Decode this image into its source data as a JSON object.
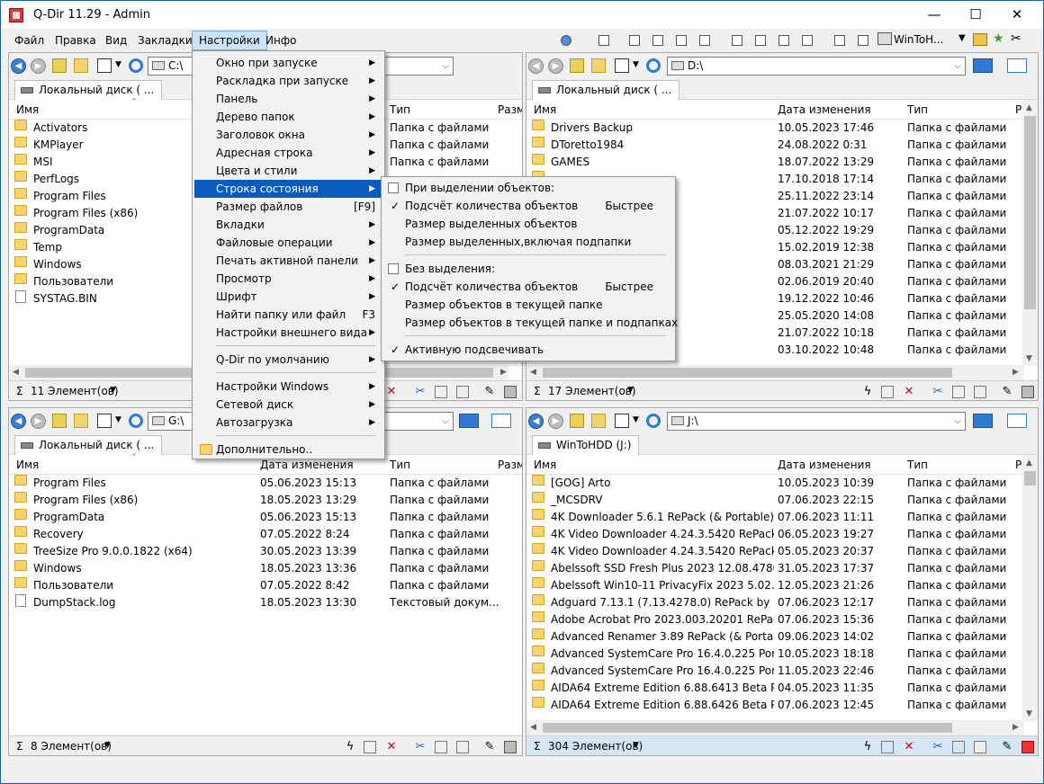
{
  "window": {
    "title": "Q-Dir 11.29 - Admin",
    "minimize": "—",
    "maximize": "☐",
    "close": "✕"
  },
  "menubar": [
    {
      "label": "Файл"
    },
    {
      "label": "Правка"
    },
    {
      "label": "Вид"
    },
    {
      "label": "Закладки"
    },
    {
      "label": "Настройки"
    },
    {
      "label": "Инфо"
    }
  ],
  "toolbar_right": {
    "drive_label": "WinToH..."
  },
  "panes": [
    {
      "address": "C:\\",
      "tab": "Локальный диск ( ...",
      "headers": [
        "Имя",
        "Дата изменения",
        "Тип",
        "Разм"
      ],
      "rows": [
        {
          "name": "Activators",
          "date": "",
          "type": "Папка с файлами",
          "icon": "folder"
        },
        {
          "name": "KMPlayer",
          "date": "",
          "type": "Папка с файлами",
          "icon": "folder"
        },
        {
          "name": "MSI",
          "date": "",
          "type": "Папка с файлами",
          "icon": "folder"
        },
        {
          "name": "PerfLogs",
          "date": "",
          "type": "",
          "icon": "folder"
        },
        {
          "name": "Program Files",
          "date": "",
          "type": "",
          "icon": "folder"
        },
        {
          "name": "Program Files (x86)",
          "date": "",
          "type": "",
          "icon": "folder"
        },
        {
          "name": "ProgramData",
          "date": "",
          "type": "",
          "icon": "folder"
        },
        {
          "name": "Temp",
          "date": "",
          "type": "",
          "icon": "folder"
        },
        {
          "name": "Windows",
          "date": "",
          "type": "",
          "icon": "folder"
        },
        {
          "name": "Пользователи",
          "date": "",
          "type": "",
          "icon": "folder"
        },
        {
          "name": "SYSTAG.BIN",
          "date": "",
          "type": "",
          "icon": "file"
        }
      ],
      "status": "11 Элемент(ов)"
    },
    {
      "address": "D:\\",
      "tab": "Локальный диск ( ...",
      "headers": [
        "Имя",
        "Дата изменения",
        "Тип",
        "Р"
      ],
      "rows": [
        {
          "name": "Drivers Backup",
          "date": "10.05.2023 17:46",
          "type": "Папка с файлами",
          "icon": "folder"
        },
        {
          "name": "DToretto1984",
          "date": "24.08.2022 0:31",
          "type": "Папка с файлами",
          "icon": "folder"
        },
        {
          "name": "GAMES",
          "date": "18.07.2022 13:29",
          "type": "Папка с файлами",
          "icon": "folder"
        },
        {
          "name": "",
          "date": "17.10.2018 17:14",
          "type": "Папка с файлами",
          "icon": "folder"
        },
        {
          "name": "",
          "date": "25.11.2022 23:14",
          "type": "Папка с файлами",
          "icon": "folder"
        },
        {
          "name": "",
          "date": "21.07.2022 10:17",
          "type": "Папка с файлами",
          "icon": "folder"
        },
        {
          "name": "",
          "date": "05.12.2022 19:29",
          "type": "Папка с файлами",
          "icon": "folder"
        },
        {
          "name": "",
          "date": "15.02.2019 12:38",
          "type": "Папка с файлами",
          "icon": "folder"
        },
        {
          "name": "",
          "date": "08.03.2021 21:29",
          "type": "Папка с файлами",
          "icon": "folder"
        },
        {
          "name": "",
          "date": "02.06.2019 20:40",
          "type": "Папка с файлами",
          "icon": "folder"
        },
        {
          "name": "",
          "date": "19.12.2022 10:46",
          "type": "Папка с файлами",
          "icon": "folder"
        },
        {
          "name": "",
          "date": "25.05.2020 14:08",
          "type": "Папка с файлами",
          "icon": "folder"
        },
        {
          "name": "",
          "date": "21.07.2022 10:18",
          "type": "Папка с файлами",
          "icon": "folder"
        },
        {
          "name": "",
          "date": "03.10.2022 10:48",
          "type": "Папка с файлами",
          "icon": "folder"
        }
      ],
      "status": "17 Элемент(ов)"
    },
    {
      "address": "G:\\",
      "tab": "Локальный диск ( ...",
      "headers": [
        "Имя",
        "Дата изменения",
        "Тип",
        "Разм"
      ],
      "rows": [
        {
          "name": "Program Files",
          "date": "05.06.2023 15:13",
          "type": "Папка с файлами",
          "icon": "folder"
        },
        {
          "name": "Program Files (x86)",
          "date": "18.05.2023 13:29",
          "type": "Папка с файлами",
          "icon": "folder"
        },
        {
          "name": "ProgramData",
          "date": "05.06.2023 15:13",
          "type": "Папка с файлами",
          "icon": "folder"
        },
        {
          "name": "Recovery",
          "date": "07.05.2022 8:24",
          "type": "Папка с файлами",
          "icon": "folder"
        },
        {
          "name": "TreeSize Pro 9.0.0.1822 (x64)",
          "date": "30.05.2023 13:39",
          "type": "Папка с файлами",
          "icon": "folder"
        },
        {
          "name": "Windows",
          "date": "18.05.2023 13:36",
          "type": "Папка с файлами",
          "icon": "folder"
        },
        {
          "name": "Пользователи",
          "date": "07.05.2022 8:42",
          "type": "Папка с файлами",
          "icon": "folder"
        },
        {
          "name": "DumpStack.log",
          "date": "18.05.2023 13:30",
          "type": "Текстовый докум...",
          "icon": "file"
        }
      ],
      "status": "8 Элемент(ов)"
    },
    {
      "address": "J:\\",
      "tab": "WinToHDD (J:)",
      "headers": [
        "Имя",
        "Дата изменения",
        "Тип",
        "Р"
      ],
      "rows": [
        {
          "name": "[GOG] Arto",
          "date": "10.05.2023 10:39",
          "type": "Папка с файлами",
          "icon": "folder"
        },
        {
          "name": "_MCSDRV",
          "date": "07.06.2023 22:15",
          "type": "Папка с файлами",
          "icon": "folder"
        },
        {
          "name": "4K Downloader 5.6.1 RePack (& Portable) by...",
          "date": "07.06.2023 11:11",
          "type": "Папка с файлами",
          "icon": "folder"
        },
        {
          "name": "4K Video Downloader 4.24.3.5420 RePack (&...",
          "date": "06.05.2023 19:27",
          "type": "Папка с файлами",
          "icon": "folder"
        },
        {
          "name": "4K Video Downloader 4.24.3.5420 RePack (&...",
          "date": "05.05.2023 20:37",
          "type": "Папка с файлами",
          "icon": "folder"
        },
        {
          "name": "Abelssoft SSD Fresh Plus 2023 12.08.47803 P...",
          "date": "31.05.2023 17:37",
          "type": "Папка с файлами",
          "icon": "folder"
        },
        {
          "name": "Abelssoft Win10-11 PrivacyFix 2023 5.02.473...",
          "date": "12.05.2023 21:26",
          "type": "Папка с файлами",
          "icon": "folder"
        },
        {
          "name": "Adguard 7.13.1 (7.13.4278.0) RePack by KpoJ...",
          "date": "07.06.2023 12:17",
          "type": "Папка с файлами",
          "icon": "folder"
        },
        {
          "name": "Adobe Acrobat Pro 2023.003.20201 RePack b...",
          "date": "07.06.2023 15:36",
          "type": "Папка с файлами",
          "icon": "folder"
        },
        {
          "name": "Advanced Renamer 3.89 RePack (& Portable...",
          "date": "09.06.2023 14:02",
          "type": "Папка с файлами",
          "icon": "folder"
        },
        {
          "name": "Advanced SystemCare Pro 16.4.0.225 Portab...",
          "date": "10.05.2023 18:18",
          "type": "Папка с файлами",
          "icon": "folder"
        },
        {
          "name": "Advanced SystemCare Pro 16.4.0.225 Portab...",
          "date": "11.05.2023 22:46",
          "type": "Папка с файлами",
          "icon": "folder"
        },
        {
          "name": "AIDA64 Extreme Edition 6.88.6413 Beta Porta...",
          "date": "04.05.2023 11:35",
          "type": "Папка с файлами",
          "icon": "folder"
        },
        {
          "name": "AIDA64 Extreme Edition 6.88.6426 Beta Porta...",
          "date": "07.06.2023 12:45",
          "type": "Папка с файлами",
          "icon": "folder"
        }
      ],
      "status": "304 Элемент(ов)"
    }
  ],
  "settings_menu": {
    "items": [
      {
        "label": "Окно при запуске",
        "arrow": "▶",
        "accel": ""
      },
      {
        "label": "Раскладка при запуске",
        "arrow": "▶",
        "accel": ""
      },
      {
        "label": "Панель",
        "arrow": "▶",
        "accel": ""
      },
      {
        "label": "Дерево папок",
        "arrow": "▶",
        "accel": ""
      },
      {
        "label": "Заголовок окна",
        "arrow": "▶",
        "accel": ""
      },
      {
        "label": "Адресная строка",
        "arrow": "▶",
        "accel": ""
      },
      {
        "label": "Цвета и стили",
        "arrow": "▶",
        "accel": ""
      },
      {
        "label": "Строка состояния",
        "arrow": "▶",
        "accel": ""
      },
      {
        "label": "Размер файлов",
        "arrow": "",
        "accel": "[F9]"
      },
      {
        "label": "Вкладки",
        "arrow": "▶",
        "accel": ""
      },
      {
        "label": "Файловые операции",
        "arrow": "▶",
        "accel": ""
      },
      {
        "label": "Печать активной панели",
        "arrow": "▶",
        "accel": ""
      },
      {
        "label": "Просмотр",
        "arrow": "▶",
        "accel": ""
      },
      {
        "label": "Шрифт",
        "arrow": "▶",
        "accel": ""
      },
      {
        "label": "Найти папку или файл",
        "arrow": "",
        "accel": "F3"
      },
      {
        "label": "Настройки внешнего вида",
        "arrow": "▶",
        "accel": ""
      },
      {
        "label": "Q-Dir по умолчанию",
        "arrow": "▶",
        "accel": ""
      },
      {
        "label": "Настройки Windows",
        "arrow": "▶",
        "accel": ""
      },
      {
        "label": "Сетевой диск",
        "arrow": "▶",
        "accel": ""
      },
      {
        "label": "Автозагрузка",
        "arrow": "▶",
        "accel": ""
      },
      {
        "label": "Дополнительно..",
        "arrow": "",
        "accel": ""
      }
    ]
  },
  "status_submenu": {
    "items": [
      {
        "label": "При выделении объектов:",
        "mark": "box",
        "accel": ""
      },
      {
        "label": "Подсчёт количества объектов",
        "mark": "✓",
        "accel": "Быстрее"
      },
      {
        "label": "Размер выделенных объектов",
        "mark": "",
        "accel": ""
      },
      {
        "label": "Размер выделенных,включая подпапки",
        "mark": "",
        "accel": ""
      },
      {
        "label": "Без выделения:",
        "mark": "box",
        "accel": ""
      },
      {
        "label": "Подсчёт количества объектов",
        "mark": "✓",
        "accel": "Быстрее"
      },
      {
        "label": "Размер объектов в текущей папке",
        "mark": "",
        "accel": ""
      },
      {
        "label": "Размер объектов в текущей папке и подпапках",
        "mark": "",
        "accel": ""
      },
      {
        "label": "Активную подсвечивать",
        "mark": "✓",
        "accel": ""
      }
    ]
  },
  "colors": {
    "accent": "#0a5bbf",
    "folder": "#f7d56a",
    "status_active": "#d6e6f5"
  }
}
